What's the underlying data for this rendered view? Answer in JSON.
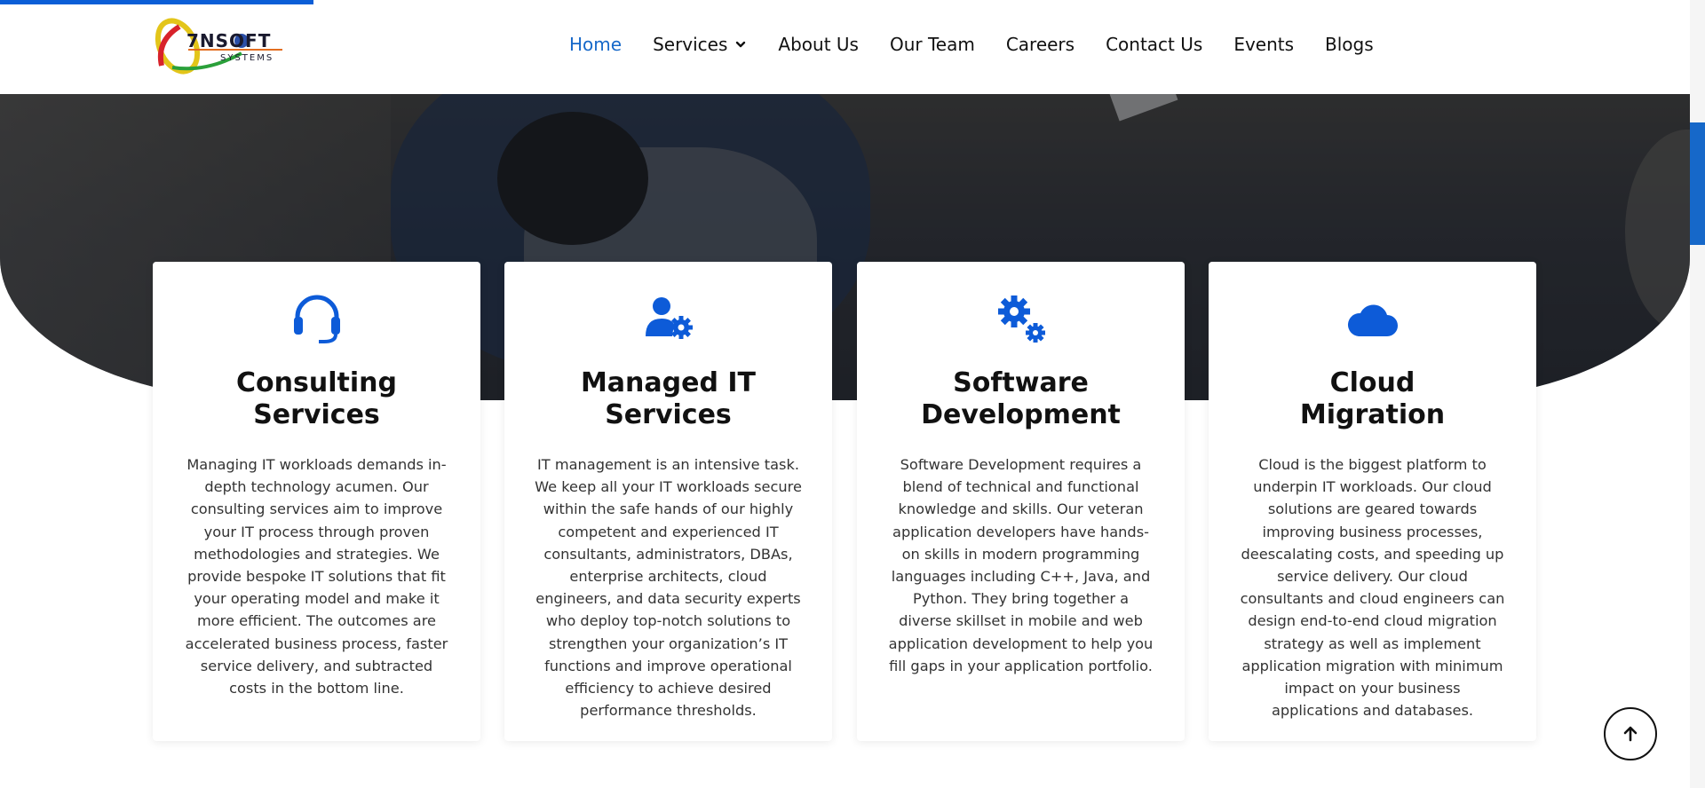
{
  "brand": {
    "logo_text": "7NSOFT",
    "logo_subtext": "SYSTEMS"
  },
  "nav": {
    "items": [
      {
        "label": "Home",
        "active": true
      },
      {
        "label": "Services",
        "has_dropdown": true
      },
      {
        "label": "About Us"
      },
      {
        "label": "Our Team"
      },
      {
        "label": "Careers"
      },
      {
        "label": "Contact Us"
      },
      {
        "label": "Events"
      },
      {
        "label": "Blogs"
      }
    ]
  },
  "services": [
    {
      "icon": "headset-icon",
      "title_line1": "Consulting",
      "title_line2": "Services",
      "text": "Managing IT workloads demands in-depth technology acumen. Our consulting services aim to improve your IT process through proven methodologies and strategies. We provide bespoke IT solutions that fit your operating model and make it more efficient. The outcomes are accelerated business process, faster service delivery, and subtracted costs in the bottom line."
    },
    {
      "icon": "user-gear-icon",
      "title_line1": "Managed IT",
      "title_line2": "Services",
      "text": "IT management is an intensive task. We keep all your IT workloads secure within the safe hands of our highly competent and experienced IT consultants, administrators, DBAs, enterprise architects, cloud engineers, and data security experts who deploy top-notch solutions to strengthen your organization’s IT functions and improve operational efficiency to achieve desired performance thresholds."
    },
    {
      "icon": "gears-icon",
      "title_line1": "Software",
      "title_line2": "Development",
      "text": "Software Development requires a blend of technical and functional knowledge and skills. Our veteran application developers have hands-on skills in modern programming languages including C++, Java, and Python. They bring together a diverse skillset in mobile and web application development to help you fill gaps in your application portfolio."
    },
    {
      "icon": "cloud-icon",
      "title_line1": "Cloud",
      "title_line2": "Migration",
      "text": "Cloud is the biggest platform to underpin IT workloads. Our cloud solutions are geared towards improving business processes, deescalating costs, and speeding up service delivery. Our cloud consultants and cloud engineers can design end-to-end cloud migration strategy as well as implement application migration with minimum impact on your business applications and databases."
    }
  ],
  "colors": {
    "accent": "#1668c9",
    "icon_blue": "#0d5bd8",
    "text_dark": "#111111"
  }
}
